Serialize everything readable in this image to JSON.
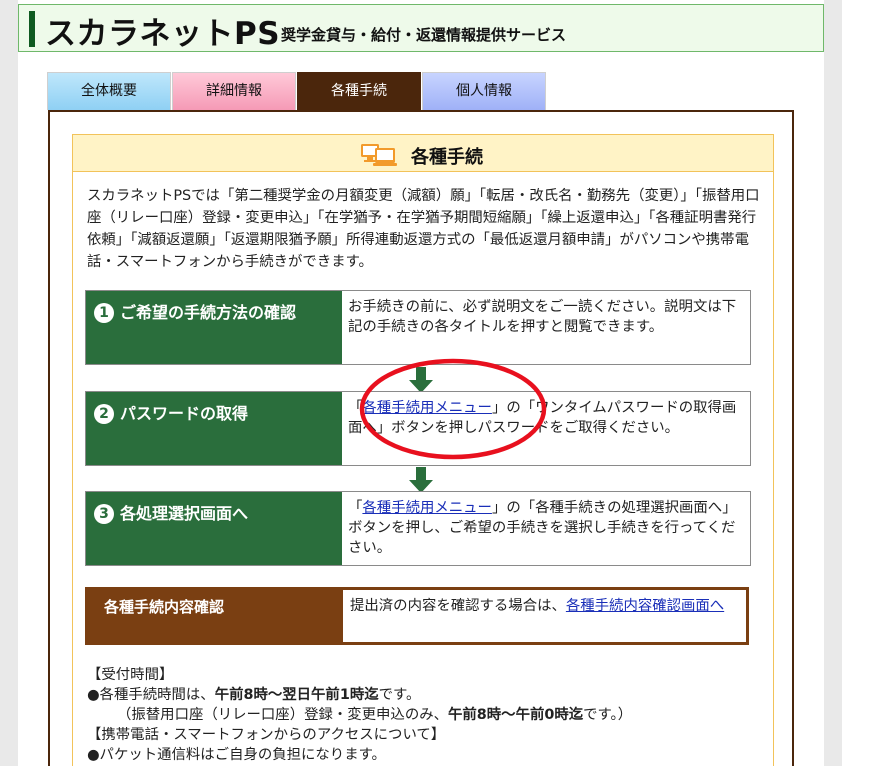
{
  "header": {
    "title": "スカラネットPS",
    "subtitle": "奨学金貸与・給付・返還情報提供サービス"
  },
  "tabs": [
    {
      "label": "全体概要",
      "active": false
    },
    {
      "label": "詳細情報",
      "active": false
    },
    {
      "label": "各種手続",
      "active": true
    },
    {
      "label": "個人情報",
      "active": false
    }
  ],
  "panel": {
    "title": "各種手続",
    "icon": "computer-icon",
    "intro": "スカラネットPSでは「第二種奨学金の月額変更（減額）願」「転居・改氏名・勤務先（変更）」「振替用口座（リレー口座）登録・変更申込」「在学猶予・在学猶予期間短縮願」「繰上返還申込」「各種証明書発行依頼」「減額返還願」「返還期限猶予願」所得連動返還方式の「最低返還月額申請」がパソコンや携帯電話・スマートフォンから手続きができます。"
  },
  "steps": [
    {
      "num": "1",
      "label": "ご希望の手続方法の確認",
      "text": "お手続きの前に、必ず説明文をご一読ください。説明文は下記の手続きの各タイトルを押すと閲覧できます。"
    },
    {
      "num": "2",
      "label": "パスワードの取得",
      "pre": "「",
      "link": "各種手続用メニュー",
      "post": "」の「ワンタイムパスワードの取得画面へ」ボタンを押しパスワードをご取得ください。"
    },
    {
      "num": "3",
      "label": "各処理選択画面へ",
      "pre": "「",
      "link": "各種手続用メニュー",
      "post": "」の「各種手続きの処理選択画面へ」ボタンを押し、ご希望の手続きを選択し手続きを行ってください。"
    }
  ],
  "confirm": {
    "label": "各種手続内容確認",
    "pre": "提出済の内容を確認する場合は、",
    "link": "各種手続内容確認画面へ"
  },
  "notes": {
    "reception_heading": "【受付時間】",
    "line1_pre": "●各種手続時間は、",
    "line1_bold": "午前8時～翌日午前1時迄",
    "line1_post": "です。",
    "line2_pre": "（振替用口座（リレー口座）登録・変更申込のみ、",
    "line2_bold": "午前8時～午前0時迄",
    "line2_post": "です。）",
    "mobile_heading": "【携帯電話・スマートフォンからのアクセスについて】",
    "line3": "●パケット通信料はご自身の負担になります。"
  },
  "colors": {
    "step_green": "#2a6e3c",
    "confirm_brown": "#7a3f12",
    "active_tab": "#4b260c",
    "link_blue": "#1a2fb8",
    "highlight_red": "#e8101e"
  }
}
